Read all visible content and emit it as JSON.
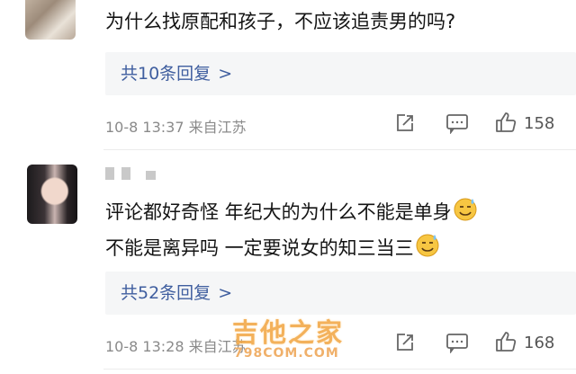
{
  "comments": [
    {
      "text": "为什么找原配和孩子，不应该追责男的吗?",
      "reply_link": "共10条回复",
      "reply_chevron": ">",
      "timestamp": "10-8 13:37",
      "location": "来自江苏",
      "likes": "158"
    },
    {
      "line1": "评论都好奇怪  年纪大的为什么不能是单身",
      "line2": "不能是离异吗  一定要说女的知三当三",
      "emoji": "sweat-smile-icon",
      "reply_link": "共52条回复",
      "reply_chevron": ">",
      "timestamp": "10-8 13:28",
      "location": "来自江苏",
      "likes": "168"
    }
  ],
  "watermark": {
    "title": "吉他之家",
    "url": "798COM.COM"
  },
  "colors": {
    "link": "#3f5e9f",
    "meta": "#8a8a8a",
    "reply_bg": "#f5f6f7"
  }
}
